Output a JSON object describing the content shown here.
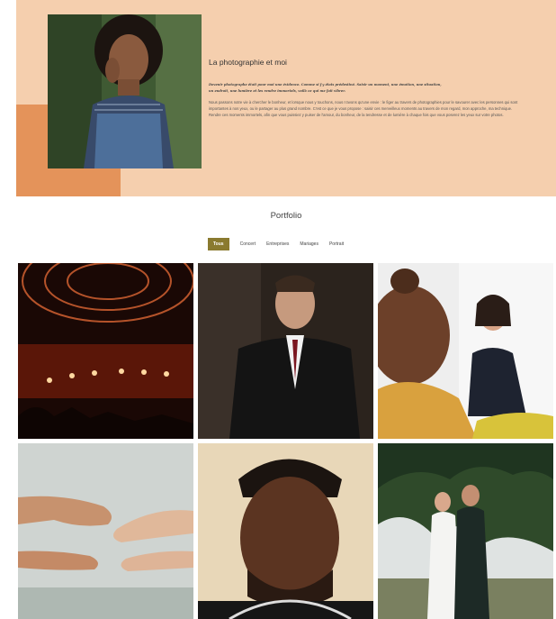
{
  "about": {
    "title": "La photographie et moi",
    "quote": "Devenir photographe était pour moi une évidence. Comme si j'y étais prédestiné. Saisir un moment, une émotion, une situation, un endroit, une lumière et les rendre immortels, voilà ce qui me fait vibrer.",
    "body": "Nous passons notre vie à chercher le bonheur, et lorsque nous y touchons, nous n'avons qu'une envie : le figer au travers de photographies pour le savourer avec les personnes qui sont importantes à nos yeux, ou le partager au plus grand nombre. C'est ce que je vous propose : saisir ces merveilleux moments au travers de mon regard, mon approche, ma technique. Rendre ces moments immortels, afin que vous puissiez y puiser de l'amour, du bonheur, de la tendresse et de lumière à chaque fois que vous poserez les yeux sur votre photos.",
    "photo_icon": "portrait-photo"
  },
  "portfolio": {
    "title": "Portfolio",
    "filters": [
      "Tous",
      "Concert",
      "Entreprises",
      "Mariages",
      "Portrait"
    ],
    "active_filter": "Tous"
  },
  "colors": {
    "about_bg": "#f5cfae",
    "about_accent": "#e4935a",
    "filter_active": "#8a7a2f"
  }
}
